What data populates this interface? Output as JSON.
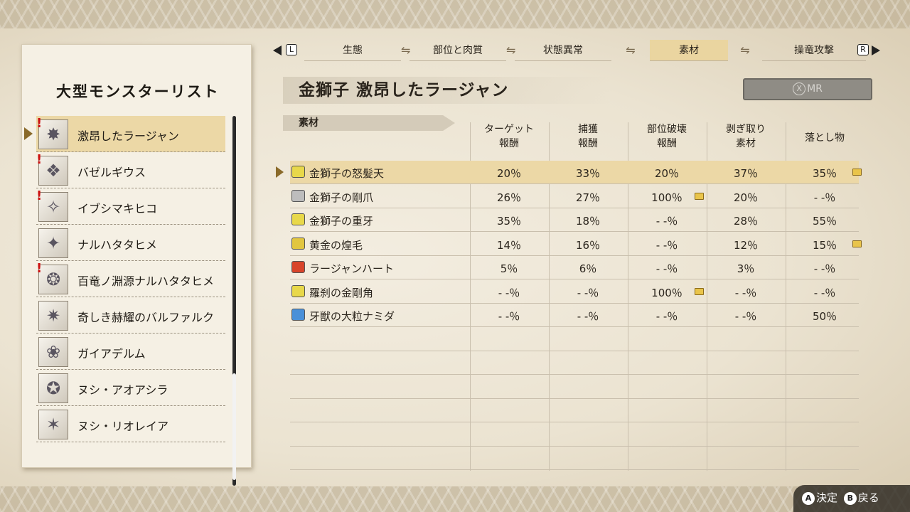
{
  "list_title": "大型モンスターリスト",
  "monsters": [
    {
      "name": "激昂したラージャン",
      "alert": true
    },
    {
      "name": "バゼルギウス",
      "alert": true
    },
    {
      "name": "イブシマキヒコ",
      "alert": true
    },
    {
      "name": "ナルハタタヒメ",
      "alert": false
    },
    {
      "name": "百竜ノ淵源ナルハタタヒメ",
      "alert": true
    },
    {
      "name": "奇しき赫耀のバルファルク",
      "alert": false
    },
    {
      "name": "ガイアデルム",
      "alert": false
    },
    {
      "name": "ヌシ・アオアシラ",
      "alert": false
    },
    {
      "name": "ヌシ・リオレイア",
      "alert": false
    }
  ],
  "alert_mark": "!",
  "tabs": {
    "left_button": "L",
    "right_button": "R",
    "items": [
      "生態",
      "部位と肉質",
      "状態異常",
      "素材",
      "操竜攻撃"
    ],
    "active": "素材"
  },
  "monster_title": "金獅子 激昂したラージャン",
  "mr_button": {
    "icon": "X",
    "label": "MR"
  },
  "section_label": "素材",
  "columns": [
    {
      "line1": "ターゲット",
      "line2": "報酬"
    },
    {
      "line1": "捕獲",
      "line2": "報酬"
    },
    {
      "line1": "部位破壊",
      "line2": "報酬"
    },
    {
      "line1": "剥ぎ取り",
      "line2": "素材"
    },
    {
      "line1": "落とし物",
      "line2": ""
    }
  ],
  "materials": [
    {
      "name": "金獅子の怒髪天",
      "icon_color": "#e8d84a",
      "values": [
        "20％",
        "33％",
        "20％",
        "37％",
        "35％"
      ],
      "notes": [
        false,
        false,
        false,
        false,
        true
      ]
    },
    {
      "name": "金獅子の剛爪",
      "icon_color": "#bdbdbd",
      "values": [
        "26％",
        "27％",
        "100％",
        "20％",
        "- -％"
      ],
      "notes": [
        false,
        false,
        true,
        false,
        false
      ]
    },
    {
      "name": "金獅子の重牙",
      "icon_color": "#e8d84a",
      "values": [
        "35％",
        "18％",
        "- -％",
        "28％",
        "55％"
      ],
      "notes": [
        false,
        false,
        false,
        false,
        false
      ]
    },
    {
      "name": "黄金の煌毛",
      "icon_color": "#e2c640",
      "values": [
        "14％",
        "16％",
        "- -％",
        "12％",
        "15％"
      ],
      "notes": [
        false,
        false,
        false,
        false,
        true
      ]
    },
    {
      "name": "ラージャンハート",
      "icon_color": "#d8442a",
      "values": [
        "5％",
        "6％",
        "- -％",
        "3％",
        "- -％"
      ],
      "notes": [
        false,
        false,
        false,
        false,
        false
      ]
    },
    {
      "name": "羅刹の金剛角",
      "icon_color": "#e8d84a",
      "values": [
        "- -％",
        "- -％",
        "100％",
        "- -％",
        "- -％"
      ],
      "notes": [
        false,
        false,
        true,
        false,
        false
      ]
    },
    {
      "name": "牙獣の大粒ナミダ",
      "icon_color": "#4a90d8",
      "values": [
        "- -％",
        "- -％",
        "- -％",
        "- -％",
        "50％"
      ],
      "notes": [
        false,
        false,
        false,
        false,
        false
      ]
    }
  ],
  "footer": {
    "confirm_button": "A",
    "confirm_label": "決定",
    "back_button": "B",
    "back_label": "戻る"
  }
}
